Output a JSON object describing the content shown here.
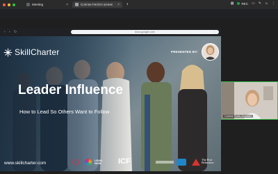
{
  "tabs": [
    {
      "label": "Meeting",
      "active": false
    },
    {
      "label": "Corinne Ferris's screen",
      "active": true
    }
  ],
  "top_right": {
    "rec_label": "REC"
  },
  "browser": {
    "url": "docs.google.com"
  },
  "slide": {
    "brand_name": "SkillCharter",
    "presented_by": "PRESENTED BY:",
    "title": "Leader Influence",
    "subtitle": "How to Lead So Others Want to Follow",
    "website": "www.skillcharter.com",
    "logos": [
      "LEAD NOW",
      "ICF",
      "The Five Behaviors"
    ]
  },
  "camera": {
    "name": "Corinne Ferris-Jonathan"
  },
  "colors": {
    "rec_green": "#1ea446",
    "camera_border": "#3cbf4e"
  }
}
